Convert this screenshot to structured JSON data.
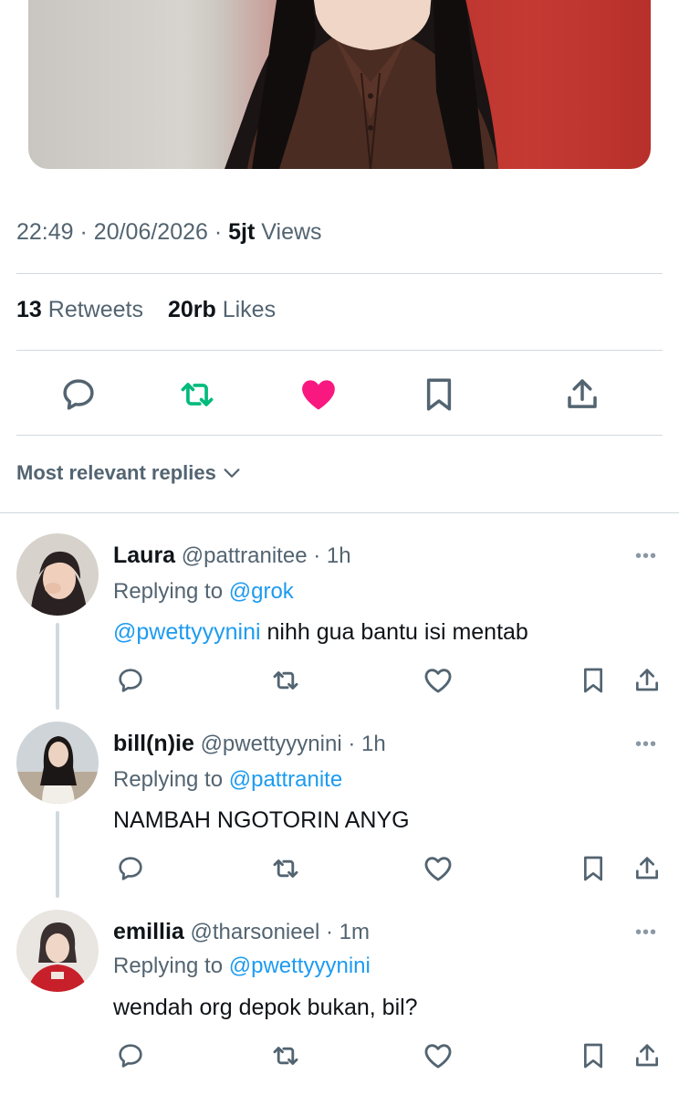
{
  "tweet": {
    "time": "22:49",
    "date": "20/06/2026",
    "sep": "·",
    "views_count": "5jt",
    "views_label": "Views",
    "retweets_count": "13",
    "retweets_label": "Retweets",
    "likes_count": "20rb",
    "likes_label": "Likes",
    "liked": true,
    "colors": {
      "like": "#f91880",
      "retweet": "#00ba7c",
      "icon": "#536471",
      "mention": "#1d9bf0"
    }
  },
  "replies_filter": {
    "label": "Most relevant replies",
    "icon": "chevron-down-icon"
  },
  "replies": [
    {
      "name": "Laura",
      "handle": "@pattranitee",
      "time": "1h",
      "replying_prefix": "Replying to",
      "replying_to": "@grok",
      "mention": "@pwettyyynini",
      "text": " nihh gua bantu isi mentab"
    },
    {
      "name": "bill(n)ie",
      "handle": "@pwettyyynini",
      "time": "1h",
      "replying_prefix": "Replying to",
      "replying_to": "@pattranite",
      "mention": "",
      "text": "NAMBAH NGOTORIN ANYG"
    },
    {
      "name": "emillia",
      "handle": "@tharsonieel",
      "time": "1m",
      "replying_prefix": "Replying to",
      "replying_to": "@pwettyyynini",
      "mention": "",
      "text": "wendah org depok bukan, bil?"
    }
  ],
  "more_glyph": "•••"
}
